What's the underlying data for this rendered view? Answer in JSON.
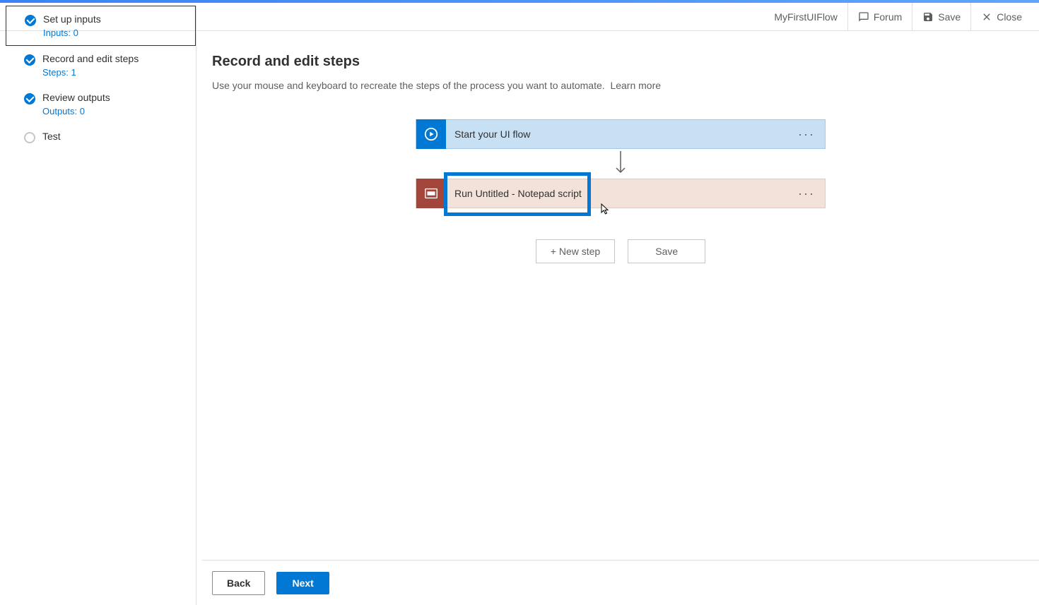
{
  "header": {
    "flow_name": "MyFirstUIFlow",
    "forum": "Forum",
    "save": "Save",
    "close": "Close"
  },
  "sidebar": {
    "steps": [
      {
        "title": "Set up inputs",
        "subtitle": "Inputs: 0"
      },
      {
        "title": "Record and edit steps",
        "subtitle": "Steps: 1"
      },
      {
        "title": "Review outputs",
        "subtitle": "Outputs: 0"
      },
      {
        "title": "Test",
        "subtitle": ""
      }
    ]
  },
  "main": {
    "title": "Record and edit steps",
    "description": "Use your mouse and keyboard to recreate the steps of the process you want to automate.",
    "learn_more": "Learn more",
    "flow": {
      "start_label": "Start your UI flow",
      "script_label": "Run Untitled - Notepad script"
    },
    "actions": {
      "new_step": "+ New step",
      "save": "Save"
    }
  },
  "footer": {
    "back": "Back",
    "next": "Next"
  }
}
